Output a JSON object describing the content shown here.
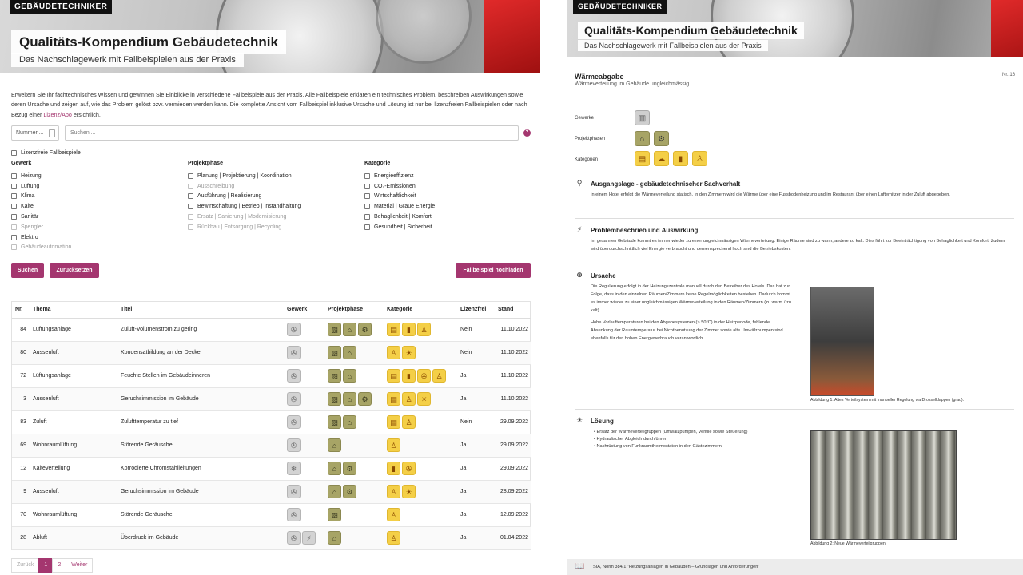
{
  "header": {
    "brand": "GEBÄUDETECHNIKER",
    "title": "Qualitäts-Kompendium Gebäudetechnik",
    "subtitle": "Das Nachschlagewerk mit Fallbeispielen aus der Praxis"
  },
  "intro": {
    "text": "Erweitern Sie Ihr fachtechnisches Wissen und gewinnen Sie Einblicke in verschiedene Fallbeispiele aus der Praxis. Alle Fallbeispiele erklären ein technisches Problem, beschreiben Auswirkungen sowie deren Ursache und zeigen auf, wie das Problem gelöst bzw. vermieden werden kann. Die komplette Ansicht vom Fallbeispiel inklusive Ursache und Lösung ist nur bei lizenzfreien Fallbeispielen oder nach Bezug einer",
    "link": "Lizenz/Abo",
    "tail": " ersichtlich."
  },
  "search": {
    "number_placeholder": "Nummer ...",
    "placeholder": "Suchen ...",
    "help_label": "?"
  },
  "filters": {
    "lizenzfrei": "Lizenzfreie Fallbeispiele",
    "gewerk": {
      "title": "Gewerk",
      "items": [
        {
          "label": "Heizung",
          "disabled": false
        },
        {
          "label": "Lüftung",
          "disabled": false
        },
        {
          "label": "Klima",
          "disabled": false
        },
        {
          "label": "Kälte",
          "disabled": false
        },
        {
          "label": "Sanitär",
          "disabled": false
        },
        {
          "label": "Spengler",
          "disabled": true
        },
        {
          "label": "Elektro",
          "disabled": false
        },
        {
          "label": "Gebäudeautomation",
          "disabled": true
        }
      ]
    },
    "projektphase": {
      "title": "Projektphase",
      "items": [
        {
          "label": "Planung | Projektierung | Koordination",
          "disabled": false
        },
        {
          "label": "Ausschreibung",
          "disabled": true
        },
        {
          "label": "Ausführung | Realisierung",
          "disabled": false
        },
        {
          "label": "Bewirtschaftung | Betrieb | Instandhaltung",
          "disabled": false
        },
        {
          "label": "Ersatz | Sanierung | Modernisierung",
          "disabled": true
        },
        {
          "label": "Rückbau | Entsorgung | Recycling",
          "disabled": true
        }
      ]
    },
    "kategorie": {
      "title": "Kategorie",
      "items": [
        {
          "label": "Energieeffizienz",
          "disabled": false
        },
        {
          "label": "CO₂-Emissionen",
          "disabled": false
        },
        {
          "label": "Wirtschaftlichkeit",
          "disabled": false
        },
        {
          "label": "Material | Graue Energie",
          "disabled": false
        },
        {
          "label": "Behaglichkeit | Komfort",
          "disabled": false
        },
        {
          "label": "Gesundheit | Sicherheit",
          "disabled": false
        }
      ]
    }
  },
  "buttons": {
    "search": "Suchen",
    "reset": "Zurücksetzen",
    "upload": "Fallbeispiel hochladen"
  },
  "table": {
    "headers": [
      "Nr.",
      "Thema",
      "Titel",
      "Gewerk",
      "Projektphase",
      "Kategorie",
      "Lizenzfrei",
      "Stand"
    ],
    "rows": [
      {
        "nr": "84",
        "thema": "Lüftungsanlage",
        "titel": "Zuluft-Volumenstrom zu gering",
        "gewerk": [
          "fan"
        ],
        "phase": [
          "plan",
          "exec",
          "ops"
        ],
        "kat": [
          "energy",
          "money",
          "health"
        ],
        "lizenz": "Nein",
        "stand": "11.10.2022"
      },
      {
        "nr": "80",
        "thema": "Aussenluft",
        "titel": "Kondensatbildung an der Decke",
        "gewerk": [
          "fan"
        ],
        "phase": [
          "plan",
          "exec"
        ],
        "kat": [
          "health",
          "comfort"
        ],
        "lizenz": "Nein",
        "stand": "11.10.2022"
      },
      {
        "nr": "72",
        "thema": "Lüftungsanlage",
        "titel": "Feuchte Stellen im Gebäudeinneren",
        "gewerk": [
          "fan"
        ],
        "phase": [
          "plan",
          "exec"
        ],
        "kat": [
          "energy",
          "money",
          "material",
          "health"
        ],
        "lizenz": "Ja",
        "stand": "11.10.2022"
      },
      {
        "nr": "3",
        "thema": "Aussenluft",
        "titel": "Geruchsimmission im Gebäude",
        "gewerk": [
          "fan"
        ],
        "phase": [
          "plan",
          "exec",
          "ops"
        ],
        "kat": [
          "energy",
          "health",
          "comfort"
        ],
        "lizenz": "Ja",
        "stand": "11.10.2022"
      },
      {
        "nr": "83",
        "thema": "Zuluft",
        "titel": "Zulufttemperatur zu tief",
        "gewerk": [
          "fan"
        ],
        "phase": [
          "plan",
          "exec"
        ],
        "kat": [
          "energy",
          "health"
        ],
        "lizenz": "Nein",
        "stand": "29.09.2022"
      },
      {
        "nr": "69",
        "thema": "Wohnraumlüftung",
        "titel": "Störende Geräusche",
        "gewerk": [
          "fan"
        ],
        "phase": [
          "exec"
        ],
        "kat": [
          "health"
        ],
        "lizenz": "Ja",
        "stand": "29.09.2022"
      },
      {
        "nr": "12",
        "thema": "Kälteverteilung",
        "titel": "Korrodierte Chromstahlleitungen",
        "gewerk": [
          "snow"
        ],
        "phase": [
          "exec",
          "ops"
        ],
        "kat": [
          "money",
          "material"
        ],
        "lizenz": "Ja",
        "stand": "29.09.2022"
      },
      {
        "nr": "9",
        "thema": "Aussenluft",
        "titel": "Geruchsimmission im Gebäude",
        "gewerk": [
          "fan"
        ],
        "phase": [
          "exec",
          "ops"
        ],
        "kat": [
          "health",
          "comfort"
        ],
        "lizenz": "Ja",
        "stand": "28.09.2022"
      },
      {
        "nr": "70",
        "thema": "Wohnraumlüftung",
        "titel": "Störende Geräusche",
        "gewerk": [
          "fan"
        ],
        "phase": [
          "plan"
        ],
        "kat": [
          "health"
        ],
        "lizenz": "Ja",
        "stand": "12.09.2022"
      },
      {
        "nr": "28",
        "thema": "Abluft",
        "titel": "Überdruck im Gebäude",
        "gewerk": [
          "fan",
          "plug"
        ],
        "phase": [
          "exec"
        ],
        "kat": [
          "health"
        ],
        "lizenz": "Ja",
        "stand": "01.04.2022"
      }
    ]
  },
  "pagination": {
    "prev": "Zurück",
    "pages": [
      "1",
      "2"
    ],
    "active": "1",
    "next": "Weiter"
  },
  "detail": {
    "header_title": "Qualitäts-Kompendium Gebäudetechnik",
    "header_subtitle": "Das Nachschlagewerk mit Fallbeispielen aus der Praxis",
    "title": "Wärmeabgabe",
    "subtitle": "Wärmeverteilung im Gebäude ungleichmässig",
    "nr": "Nr. 16",
    "labels": {
      "gewerke": "Gewerke",
      "projektphasen": "Projektphasen",
      "kategorien": "Kategorien"
    },
    "sections": {
      "ausgangslage": {
        "title": "Ausgangslage - gebäudetechnischer Sachverhalt",
        "text": "In einem Hotel erfolgt die Wärmeverteilung statisch. In den Zimmern wird die Wärme über eine Fussbodenheizung und im Restaurant über einen Lufterhitzer in der Zuluft abgegeben."
      },
      "problem": {
        "title": "Problembeschrieb und Auswirkung",
        "text": "Im gesamten Gebäude kommt es immer wieder zu einer ungleichmässigen Wärmeverteilung. Einige Räume sind zu warm, andere zu kalt. Dies führt zur Beeinträchtigung von Behaglichkeit und Komfort. Zudem wird überdurchschnittlich viel Energie verbraucht und demensprechend hoch sind die Betriebskosten."
      },
      "ursache": {
        "title": "Ursache",
        "text1": "Die Regulierung erfolgt in der Heizungszentrale manuell durch den Betreiber des Hotels. Das hat zur Folge, dass in den einzelnen Räumen/Zimmern keine Regelmöglichkeiten bestehen. Dadurch kommt es immer wieder zu einer ungleichmässigen Wärmeverteilung in den Räumen/Zimmern (zu warm / zu kalt).",
        "text2": "Hohe Vorlauftemperaturen bei den Abgabesystemen (> 50°C) in der Heizperiode, fehlende Absenkung der Raumtemperatur bei Nichtbenutzung der Zimmer sowie alte Umwälzpumpen sind ebenfalls für den hohen Energieverbrauch verantwortlich.",
        "caption": "Abbildung 1: Altes Verteilsystem mit manueller Regelung via Drosselklappen (grau)."
      },
      "loesung": {
        "title": "Lösung",
        "bullets": [
          "Ersatz der Wärmeverteilgruppen (Umwälzpumpen, Ventile sowie Steuerung)",
          "Hydraulischer Abgleich durchführen",
          "Nachrüstung von Funkraumthermostaten in den Gästezimmern"
        ],
        "caption": "Abbildung 2: Neue Wärmeverteilgruppen."
      }
    },
    "footer": "SIA, Norm 384/1 \"Heizungsanlagen in Gebäuden – Grundlagen und Anforderungen\""
  },
  "icons": {
    "fan": "✇",
    "snow": "❄",
    "plug": "⚡",
    "plan": "▨",
    "exec": "⌂",
    "ops": "⚙",
    "energy": "▤",
    "money": "▮",
    "material": "✇",
    "health": "♙",
    "comfort": "☀"
  }
}
